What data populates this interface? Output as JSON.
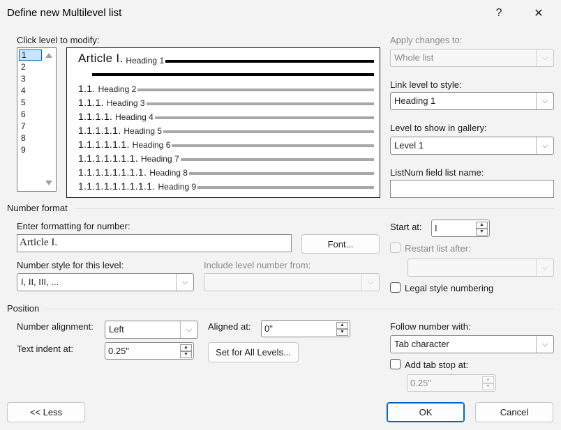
{
  "window": {
    "title": "Define new Multilevel list",
    "help_icon": "?",
    "close_icon": "✕"
  },
  "levels": {
    "label": "Click level to modify:",
    "items": [
      "1",
      "2",
      "3",
      "4",
      "5",
      "6",
      "7",
      "8",
      "9"
    ],
    "selected": "1"
  },
  "preview": {
    "rows": [
      {
        "number": "Article I.",
        "heading": "Heading 1"
      },
      {
        "number": "1.1.",
        "heading": "Heading 2"
      },
      {
        "number": "1.1.1.",
        "heading": "Heading 3"
      },
      {
        "number": "1.1.1.1.",
        "heading": "Heading 4"
      },
      {
        "number": "1.1.1.1.1.",
        "heading": "Heading 5"
      },
      {
        "number": "1.1.1.1.1.1.",
        "heading": "Heading 6"
      },
      {
        "number": "1.1.1.1.1.1.1.",
        "heading": "Heading 7"
      },
      {
        "number": "1.1.1.1.1.1.1.1.",
        "heading": "Heading 8"
      },
      {
        "number": "1.1.1.1.1.1.1.1.1.",
        "heading": "Heading 9"
      }
    ]
  },
  "right_panel": {
    "apply_label": "Apply changes to:",
    "apply_value": "Whole list",
    "link_label": "Link level to style:",
    "link_value": "Heading 1",
    "gallery_label": "Level to show in gallery:",
    "gallery_value": "Level 1",
    "listnum_label": "ListNum field list name:",
    "listnum_value": ""
  },
  "number_format": {
    "section": "Number format",
    "enter_label": "Enter formatting for number:",
    "enter_value": "Article I.",
    "font_button": "Font...",
    "style_label": "Number style for this level:",
    "style_value": "I, II, III, ...",
    "include_label": "Include level number from:",
    "include_value": "",
    "start_label": "Start at:",
    "start_value": "I",
    "restart_label": "Restart list after:",
    "restart_value": "",
    "legal_label": "Legal style numbering"
  },
  "position": {
    "section": "Position",
    "alignment_label": "Number alignment:",
    "alignment_value": "Left",
    "aligned_at_label": "Aligned at:",
    "aligned_at_value": "0\"",
    "indent_label": "Text indent at:",
    "indent_value": "0.25\"",
    "set_all_button": "Set for All Levels...",
    "follow_label": "Follow number with:",
    "follow_value": "Tab character",
    "tabstop_label": "Add tab stop at:",
    "tabstop_value": "0.25\""
  },
  "footer": {
    "less_button": "<< Less",
    "ok_button": "OK",
    "cancel_button": "Cancel"
  }
}
